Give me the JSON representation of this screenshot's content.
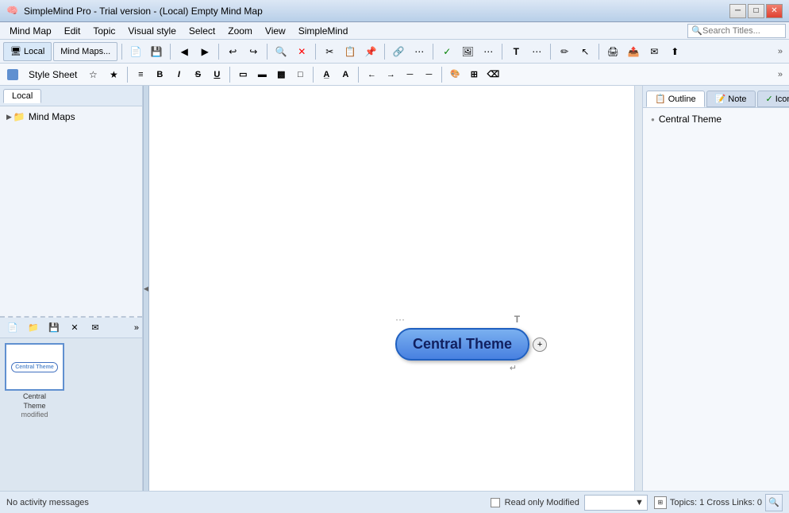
{
  "window": {
    "title": "SimpleMind Pro - Trial version - (Local) Empty Mind Map",
    "icon": "🧠"
  },
  "menubar": {
    "items": [
      "Mind Map",
      "Edit",
      "Topic",
      "Visual style",
      "Select",
      "Zoom",
      "View",
      "SimpleMind"
    ],
    "search_placeholder": "Search Titles...",
    "search_icon": "🔍"
  },
  "toolbar1": {
    "local_tab": "Local",
    "mindmaps_btn": "Mind Maps...",
    "expand_btn": "»"
  },
  "toolbar2": {
    "stylesheet_label": "Style Sheet",
    "expand_btn": "»"
  },
  "left_panel": {
    "tab_label": "Local",
    "tree_items": [
      {
        "label": "Mind Maps",
        "icon": "📁",
        "arrow": "▶"
      }
    ]
  },
  "thumbnails": {
    "item_label_line1": "Central",
    "item_label_line2": "Theme",
    "item_modified": "modified"
  },
  "canvas": {
    "central_theme_text": "Central Theme",
    "dots_icon": "···",
    "t_icon": "T",
    "plus_icon": "+",
    "arrow_icon": "↵"
  },
  "right_panel": {
    "tabs": [
      "Outline",
      "Note",
      "Icon"
    ],
    "active_tab": "Outline",
    "outline_items": [
      {
        "label": "Central Theme"
      }
    ]
  },
  "status_bar": {
    "no_activity": "No activity messages",
    "read_only_label": "Read only Modified",
    "topics_label": "Topics: 1  Cross Links: 0",
    "search_icon": "🔍"
  }
}
